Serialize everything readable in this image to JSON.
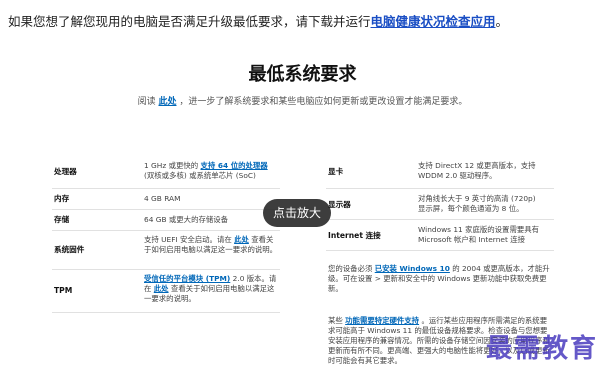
{
  "intro": {
    "text": "如果您想了解您现用的电脑是否满足升级最低要求，请下载并运行",
    "link": "电脑健康状况检查应用",
    "end": "。"
  },
  "heading": "最低系统要求",
  "subline": {
    "pre": "阅读",
    "link": "此处",
    "post": "，进一步了解系统要求和某些电脑应如何更新或更改设置才能满足要求。"
  },
  "left_table": [
    {
      "label": "处理器",
      "lines": [
        "1 GHz 或更快的",
        "支持 64 位的处理器",
        "(双核或多核) 或系统单芯片 (SoC)"
      ]
    },
    {
      "label": "内存",
      "lines": [
        "4 GB RAM"
      ]
    },
    {
      "label": "存储",
      "lines": [
        "64 GB 或更大的存储设备"
      ]
    },
    {
      "label": "系统固件",
      "lines": [
        "支持 UEFI 安全启动。请在",
        "此处",
        "查看关于如何启用电脑以满足这一要求的说明。"
      ]
    },
    {
      "label": "TPM",
      "lines": [
        "受信任的平台模块 (TPM)",
        "2.0 版本。请在",
        "此处",
        "查看关于如何启用电脑以满足这一要求的说明。"
      ]
    }
  ],
  "right_table": [
    {
      "label": "显卡",
      "lines": [
        "支持 DirectX 12 或更高版本，支持",
        "WDDM 2.0 驱动程序。"
      ]
    },
    {
      "label": "显示器",
      "lines": [
        "对角线长大于 9 英寸的高清 (720p)",
        "显示屏，每个颜色通道为 8 位。"
      ]
    },
    {
      "label": "Internet 连接",
      "lines": [
        "Windows 11 家庭版的设置需要具有",
        "Microsoft 帐户和 Internet 连接"
      ]
    }
  ],
  "right_para1": {
    "pre": "您的设备必须",
    "link": "已安装 Windows 10",
    "post": "的 2004 或更高版本，才能升级。可在设置 > 更新和安全中的 Windows 更新功能中获取免费更新。"
  },
  "right_para2": {
    "pre": "某些",
    "link": "功能需要特定硬件支持",
    "post": "。运行某些应用程序所需满足的系统要求可能高于 Windows 11 的最低设备规格要求。检查设备与您想要安装应用程序的兼容情况。所需的设备存储空间因安装的应用程序和更新而有所不同。更高端、更强大的电脑性能将更好，以及后或更新时可能会有其它要求。"
  },
  "zoom_badge": "点击放大",
  "watermark": "最需教育"
}
